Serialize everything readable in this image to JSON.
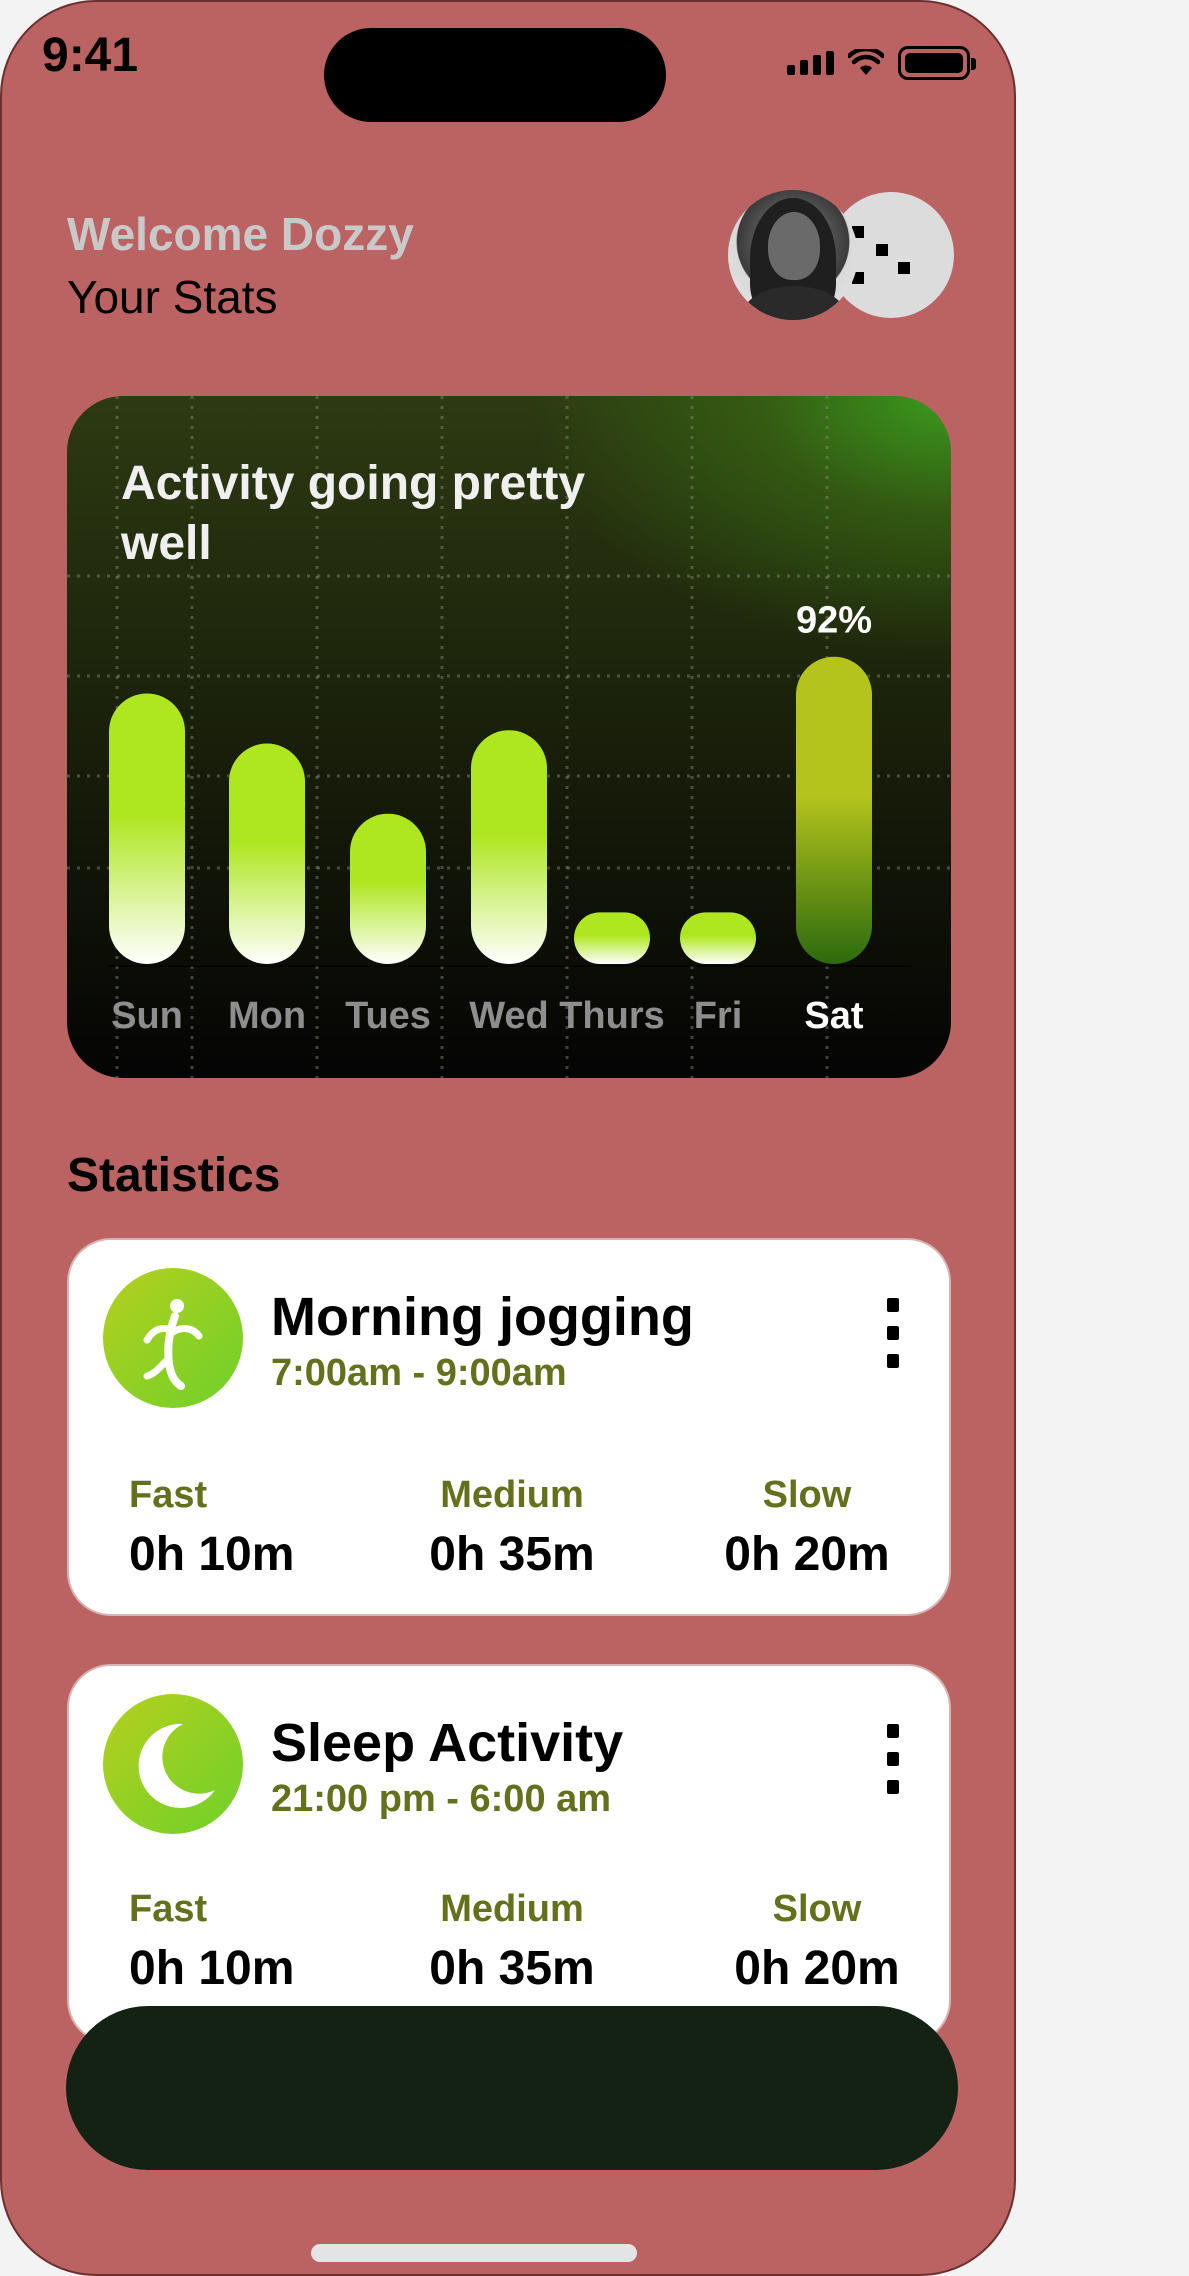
{
  "status_bar": {
    "time": "9:41"
  },
  "header": {
    "welcome": "Welcome Dozzy",
    "title": "Your Stats"
  },
  "activity": {
    "title": "Activity going pretty well",
    "highlight_label": "92%",
    "colors": {
      "bar_top": "#aee620",
      "bar_bottom": "#ffffff",
      "highlight_top": "#b5c41c",
      "highlight_bottom": "#2c6a0e"
    }
  },
  "chart_data": {
    "type": "bar",
    "title": "Activity going pretty well",
    "categories": [
      "Sun",
      "Mon",
      "Tues",
      "Wed",
      "Thurs",
      "Fri",
      "Sat"
    ],
    "values": [
      81,
      66,
      45,
      70,
      10,
      10,
      92
    ],
    "highlighted": "Sat",
    "data_labels": {
      "Sat": "92%"
    },
    "ylim": [
      0,
      100
    ],
    "grid": true
  },
  "statistics": {
    "heading": "Statistics",
    "cards": [
      {
        "title": "Morning jogging",
        "time": "7:00am - 9:00am",
        "icon": "running-person-icon",
        "metrics": [
          {
            "label": "Fast",
            "value": "0h 10m"
          },
          {
            "label": "Medium",
            "value": "0h 35m"
          },
          {
            "label": "Slow",
            "value": "0h 20m"
          }
        ]
      },
      {
        "title": "Sleep Activity",
        "time": "21:00 pm - 6:00 am",
        "icon": "crescent-moon-icon",
        "metrics": [
          {
            "label": "Fast",
            "value": "0h 10m"
          },
          {
            "label": "Medium",
            "value": "0h 35m"
          },
          {
            "label": "Slow",
            "value": "0h 20m"
          }
        ]
      }
    ]
  },
  "theme": {
    "background": "#bb6262",
    "accent_green": "#6fd12a",
    "muted_olive": "#64701c",
    "bottom_bar": "#132212"
  }
}
